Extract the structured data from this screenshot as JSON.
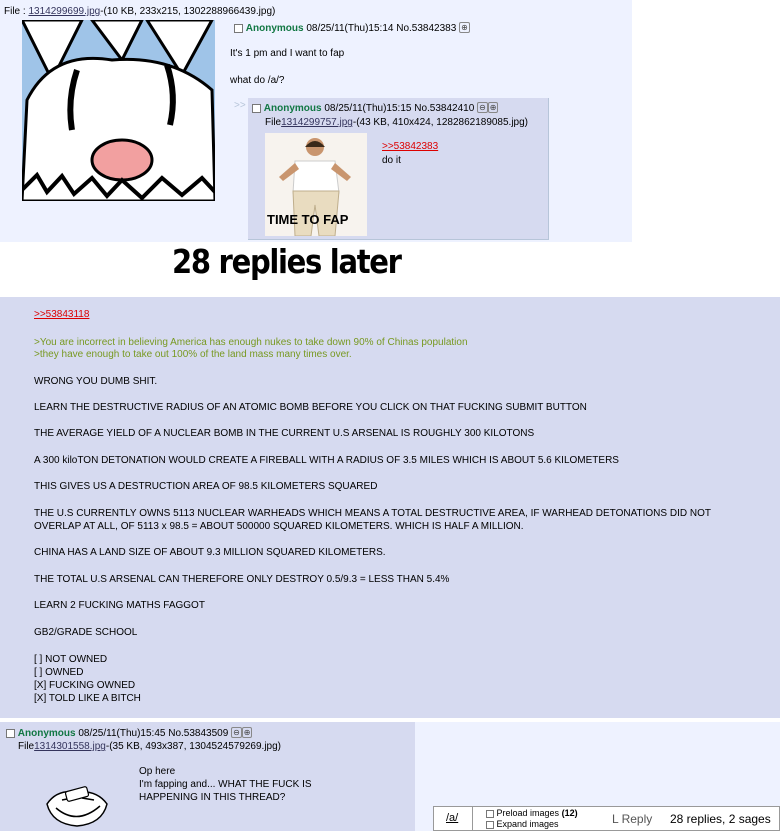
{
  "top_post": {
    "file_label": "File :",
    "file_name": "1314299699.jpg",
    "file_meta": "-(10 KB, 233x215, 1302288966439.jpg)",
    "author": "Anonymous",
    "datetime": "08/25/11(Thu)15:14",
    "post_no": "No.53842383",
    "lines": [
      "It's 1 pm and I want to fap",
      "what do /a/?"
    ]
  },
  "reply1": {
    "arrows": ">>",
    "author": "Anonymous",
    "datetime": "08/25/11(Thu)15:15",
    "post_no": "No.53842410",
    "file_label": "File",
    "file_name": "1314299757.jpg",
    "file_meta": "-(43 KB, 410x424, 1282862189085.jpg)",
    "quote_link": ">>53842383",
    "text": "do it",
    "image_caption": "TIME TO FAP"
  },
  "banner": "28 replies later",
  "big_reply": {
    "quote_link": ">>53843118",
    "greentext": [
      ">You are incorrect in believing America has enough nukes to take down 90% of Chinas population",
      ">they have enough to take out 100% of the land mass many times over."
    ],
    "lines": [
      "WRONG YOU DUMB SHIT.",
      "LEARN THE DESTRUCTIVE RADIUS OF AN ATOMIC BOMB BEFORE YOU CLICK ON THAT FUCKING SUBMIT BUTTON",
      "THE AVERAGE YIELD OF A NUCLEAR BOMB IN THE CURRENT U.S ARSENAL IS ROUGHLY 300 KILOTONS",
      "A 300 kiloTON DETONATION WOULD CREATE A FIREBALL WITH A RADIUS OF 3.5 MILES WHICH IS ABOUT 5.6 KILOMETERS",
      "THIS GIVES US A DESTRUCTION AREA OF 98.5 KILOMETERS SQUARED",
      "THE U.S CURRENTLY OWNS 5113 NUCLEAR WARHEADS WHICH MEANS A TOTAL DESTRUCTIVE AREA, IF WARHEAD DETONATIONS DID NOT",
      "OVERLAP AT ALL, OF 5113 x 98.5 = ABOUT 500000 SQUARED KILOMETERS. WHICH IS HALF A MILLION.",
      "CHINA HAS A LAND SIZE OF ABOUT 9.3 MILLION SQUARED KILOMETERS.",
      "THE TOTAL U.S ARSENAL CAN THEREFORE ONLY DESTROY 0.5/9.3 = LESS THAN 5.4%",
      "LEARN 2 FUCKING MATHS FAGGOT",
      "GB2/GRADE SCHOOL",
      "[ ] NOT OWNED",
      "[ ] OWNED",
      "[X] FUCKING OWNED",
      "[X] TOLD LIKE A BITCH"
    ]
  },
  "last_post": {
    "author": "Anonymous",
    "datetime": "08/25/11(Thu)15:45",
    "post_no": "No.53843509",
    "file_label": "File",
    "file_name": "1314301558.jpg",
    "file_meta": "-(35 KB, 493x387, 1304524579269.jpg)",
    "lines": [
      "Op here",
      "I'm fapping and... WHAT THE FUCK IS",
      "HAPPENING IN THIS THREAD?"
    ]
  },
  "navbar": {
    "board": "/a/",
    "preload_label": "Preload images",
    "preload_count": "(12)",
    "expand_label": "Expand images",
    "reply_label": "Reply",
    "reply_glyph": "L",
    "stats": "28 replies, 2 sages"
  },
  "colors": {
    "post_bg": "#d6daf0",
    "page_bg": "#eef2ff",
    "name_green": "#117743",
    "quote_red": "#dd0000",
    "greentext": "#789922"
  }
}
